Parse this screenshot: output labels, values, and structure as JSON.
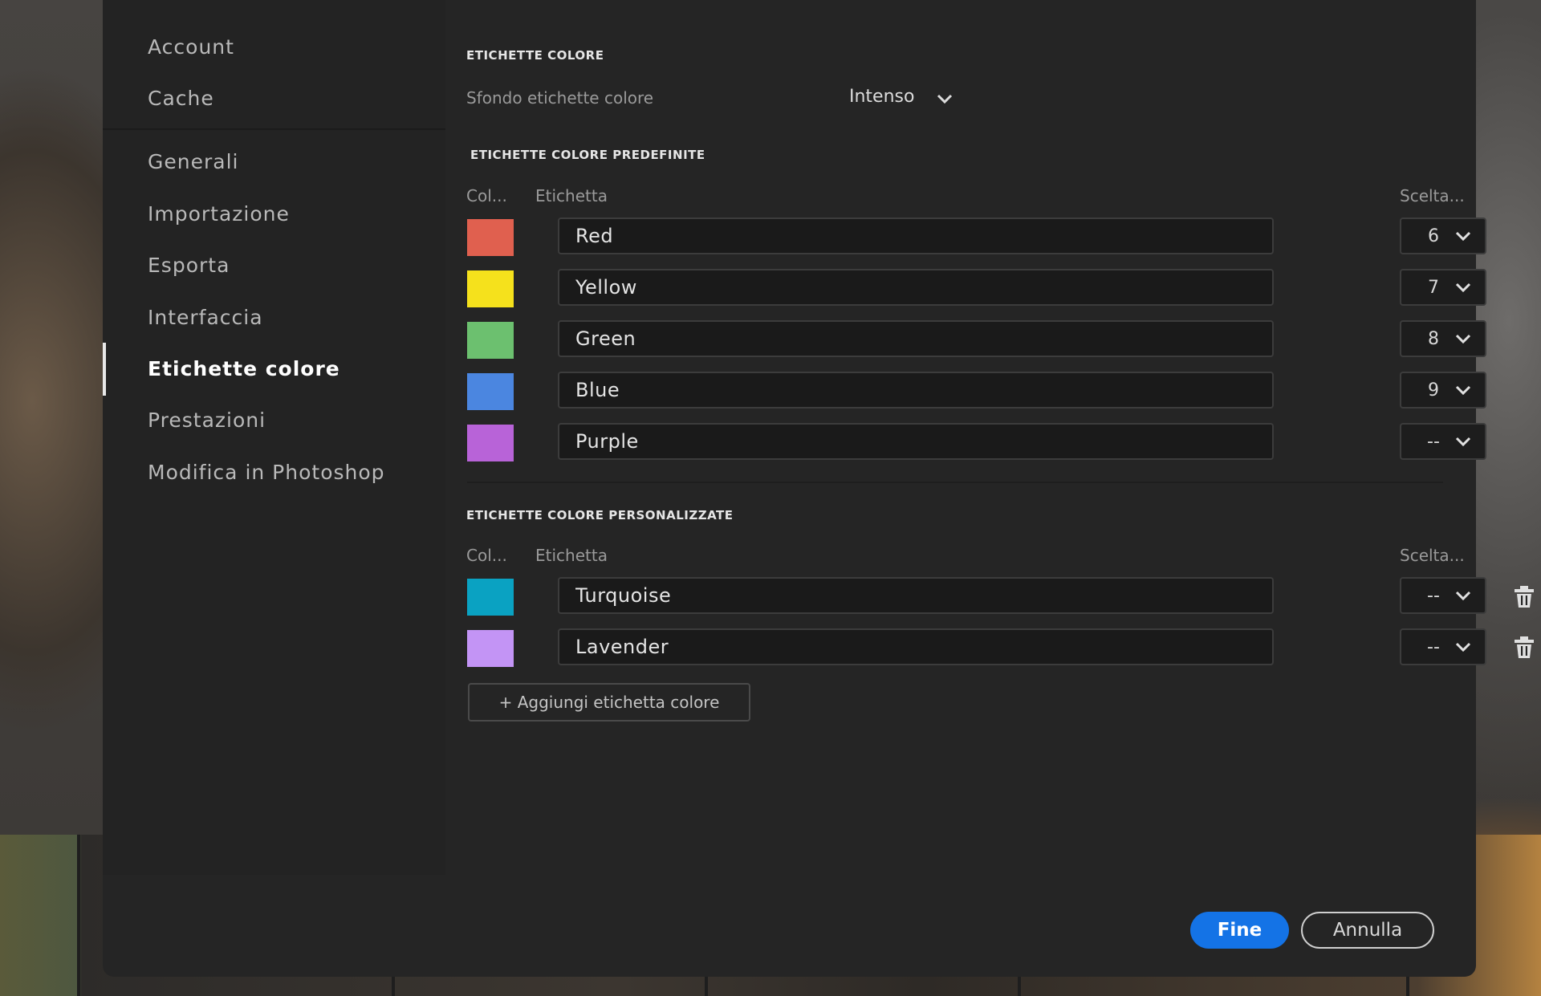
{
  "sidebar": {
    "items": [
      {
        "label": "Account",
        "active": false
      },
      {
        "label": "Cache",
        "active": false
      },
      {
        "label": "Generali",
        "active": false
      },
      {
        "label": "Importazione",
        "active": false
      },
      {
        "label": "Esporta",
        "active": false
      },
      {
        "label": "Interfaccia",
        "active": false
      },
      {
        "label": "Etichette colore",
        "active": true
      },
      {
        "label": "Prestazioni",
        "active": false
      },
      {
        "label": "Modifica in Photoshop",
        "active": false
      }
    ]
  },
  "main": {
    "section_title": "ETICHETTE COLORE",
    "background_label": "Sfondo etichette colore",
    "background_value": "Intenso",
    "predefined": {
      "title": "ETICHETTE COLORE PREDEFINITE",
      "col_color": "Col...",
      "col_label": "Etichetta",
      "col_shortcut": "Scelta...",
      "rows": [
        {
          "color": "#e0604f",
          "label": "Red",
          "shortcut": "6"
        },
        {
          "color": "#f5e11c",
          "label": "Yellow",
          "shortcut": "7"
        },
        {
          "color": "#6cc06f",
          "label": "Green",
          "shortcut": "8"
        },
        {
          "color": "#4b86e0",
          "label": "Blue",
          "shortcut": "9"
        },
        {
          "color": "#b863d8",
          "label": "Purple",
          "shortcut": "--"
        }
      ]
    },
    "custom": {
      "title": "ETICHETTE COLORE PERSONALIZZATE",
      "col_color": "Col...",
      "col_label": "Etichetta",
      "col_shortcut": "Scelta...",
      "rows": [
        {
          "color": "#0aa2c2",
          "label": "Turquoise",
          "shortcut": "--"
        },
        {
          "color": "#c394f5",
          "label": "Lavender",
          "shortcut": "--"
        }
      ],
      "add_label": "+ Aggiungi etichetta colore"
    }
  },
  "footer": {
    "done_label": "Fine",
    "cancel_label": "Annulla"
  },
  "colors": {
    "accent": "#1473e6",
    "dialog_bg": "#252525"
  }
}
